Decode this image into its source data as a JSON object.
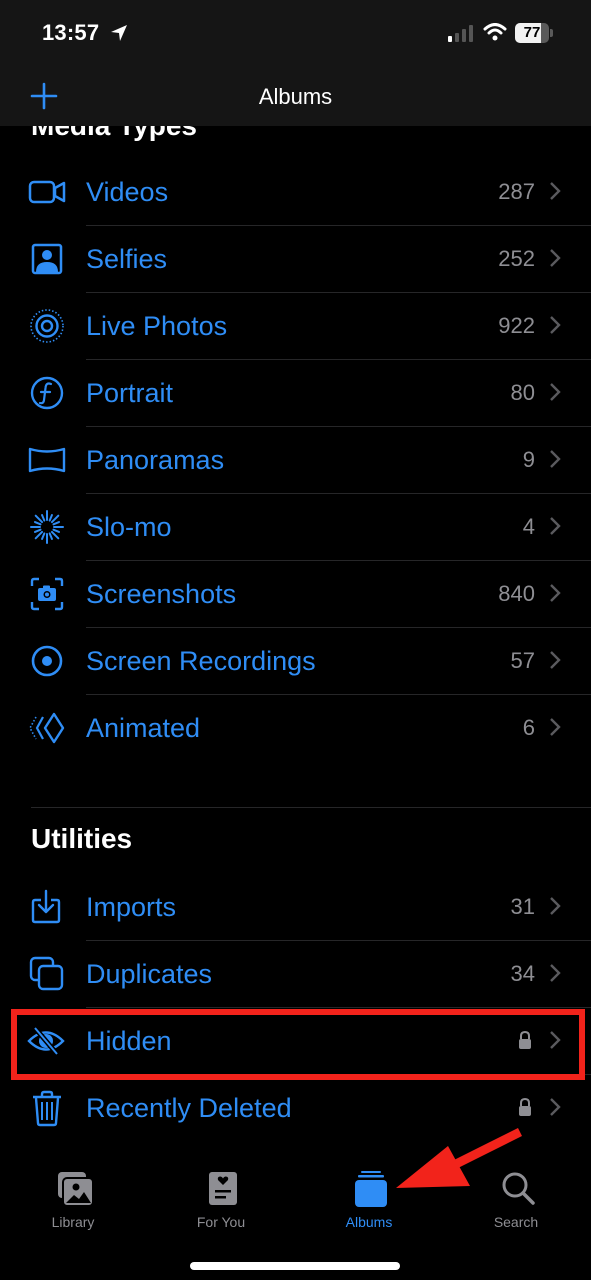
{
  "status_bar": {
    "time": "13:57",
    "location_icon": "location-arrow-icon",
    "signal_icon": "cellular-signal-icon",
    "wifi_icon": "wifi-icon",
    "battery_percent": 77,
    "battery_label": "77"
  },
  "nav": {
    "title": "Albums",
    "add_icon": "plus-icon"
  },
  "colors": {
    "accent": "#2f8df5",
    "secondary_text": "#8e8e93",
    "annotation": "#f2231b",
    "background": "#000000",
    "bar_background": "#151515"
  },
  "media_types": {
    "title": "Media Types",
    "items": [
      {
        "label": "Videos",
        "count": "287",
        "icon": "video-camera-icon"
      },
      {
        "label": "Selfies",
        "count": "252",
        "icon": "selfie-portrait-icon"
      },
      {
        "label": "Live Photos",
        "count": "922",
        "icon": "live-photo-icon"
      },
      {
        "label": "Portrait",
        "count": "80",
        "icon": "portrait-f-icon"
      },
      {
        "label": "Panoramas",
        "count": "9",
        "icon": "panorama-icon"
      },
      {
        "label": "Slo-mo",
        "count": "4",
        "icon": "slomo-icon"
      },
      {
        "label": "Screenshots",
        "count": "840",
        "icon": "screenshot-camera-icon"
      },
      {
        "label": "Screen Recordings",
        "count": "57",
        "icon": "screen-recording-icon"
      },
      {
        "label": "Animated",
        "count": "6",
        "icon": "animated-icon"
      }
    ]
  },
  "utilities": {
    "title": "Utilities",
    "items": [
      {
        "label": "Imports",
        "count": "31",
        "icon": "import-tray-icon",
        "locked": false
      },
      {
        "label": "Duplicates",
        "count": "34",
        "icon": "duplicates-icon",
        "locked": false
      },
      {
        "label": "Hidden",
        "count": "",
        "icon": "eye-slash-icon",
        "locked": true
      },
      {
        "label": "Recently Deleted",
        "count": "",
        "icon": "trash-icon",
        "locked": true
      }
    ]
  },
  "tab_bar": {
    "tabs": [
      {
        "label": "Library",
        "icon": "photo-library-icon",
        "active": false
      },
      {
        "label": "For You",
        "icon": "for-you-heart-card-icon",
        "active": false
      },
      {
        "label": "Albums",
        "icon": "albums-stack-icon",
        "active": true
      },
      {
        "label": "Search",
        "icon": "magnifying-glass-icon",
        "active": false
      }
    ]
  },
  "annotations": {
    "highlight_target": "Hidden",
    "arrow_target": "Albums"
  }
}
